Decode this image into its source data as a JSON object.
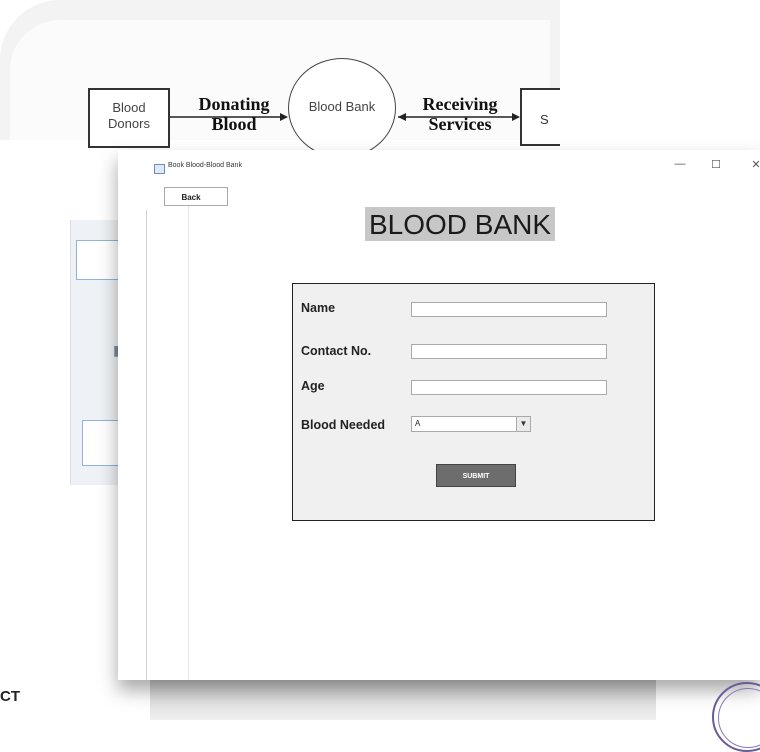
{
  "diagram": {
    "donors_label": "Blood Donors",
    "donating_label": "Donating Blood",
    "bank_label": "Blood Bank",
    "receiving_label": "Receiving Services",
    "s_label": "S"
  },
  "window": {
    "title": "Book Blood-Blood Bank",
    "minimize": "—",
    "maximize": "☐",
    "close": "✕"
  },
  "app": {
    "back_label": "Back",
    "heading": "BLOOD BANK",
    "form": {
      "name_label": "Name",
      "contact_label": "Contact No.",
      "age_label": "Age",
      "blood_needed_label": "Blood Needed",
      "blood_needed_value": "A",
      "submit_label": "SUBMIT"
    }
  },
  "slide": {
    "footer_text": "CT"
  },
  "colors": {
    "form_bg": "#f0f0f0",
    "submit_bg": "#6d6d6d",
    "heading_bg": "#c7c7c7"
  }
}
